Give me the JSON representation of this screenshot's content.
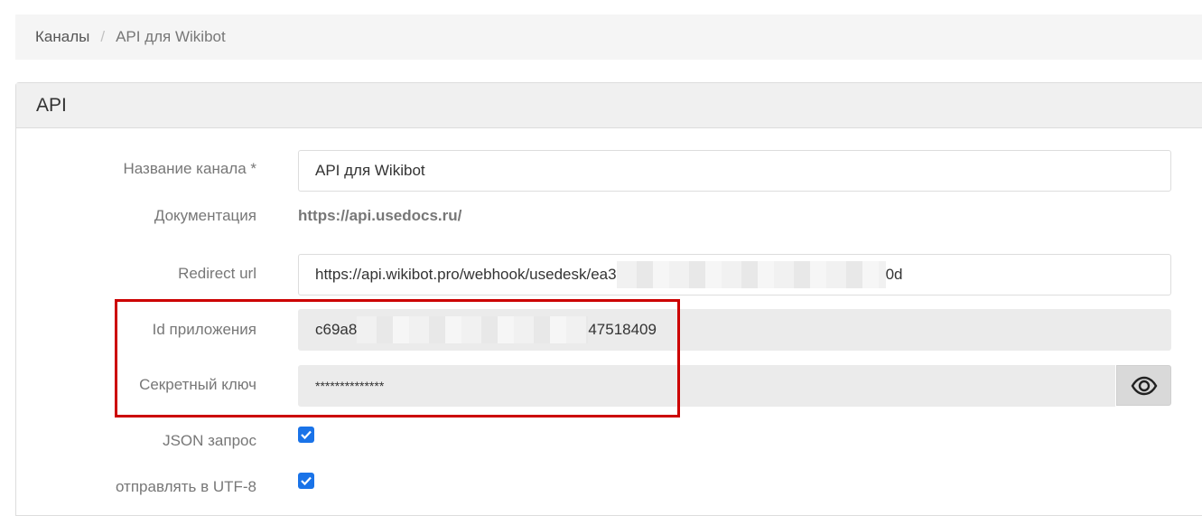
{
  "breadcrumb": {
    "parent": "Каналы",
    "separator": "/",
    "current": "API для Wikibot"
  },
  "panel": {
    "title": "API"
  },
  "form": {
    "channel_name_label": "Название канала *",
    "channel_name_value": "API для Wikibot",
    "documentation_label": "Документация",
    "documentation_link": "https://api.usedocs.ru/",
    "redirect_label": "Redirect url",
    "redirect_prefix": "https://api.wikibot.pro/webhook/usedesk/ea3",
    "redirect_suffix": "0d",
    "app_id_label": "Id приложения",
    "app_id_prefix": "c69a8",
    "app_id_suffix": "47518409",
    "secret_label": "Секретный ключ",
    "secret_value": "**************",
    "json_label": "JSON запрос",
    "json_checked": true,
    "utf8_label": "отправлять в UTF-8",
    "utf8_checked": true
  },
  "colors": {
    "highlight": "#cc0000",
    "checkbox": "#1a73e8"
  },
  "icons": {
    "show_secret": "eye-icon",
    "checkmark": "check-icon"
  }
}
